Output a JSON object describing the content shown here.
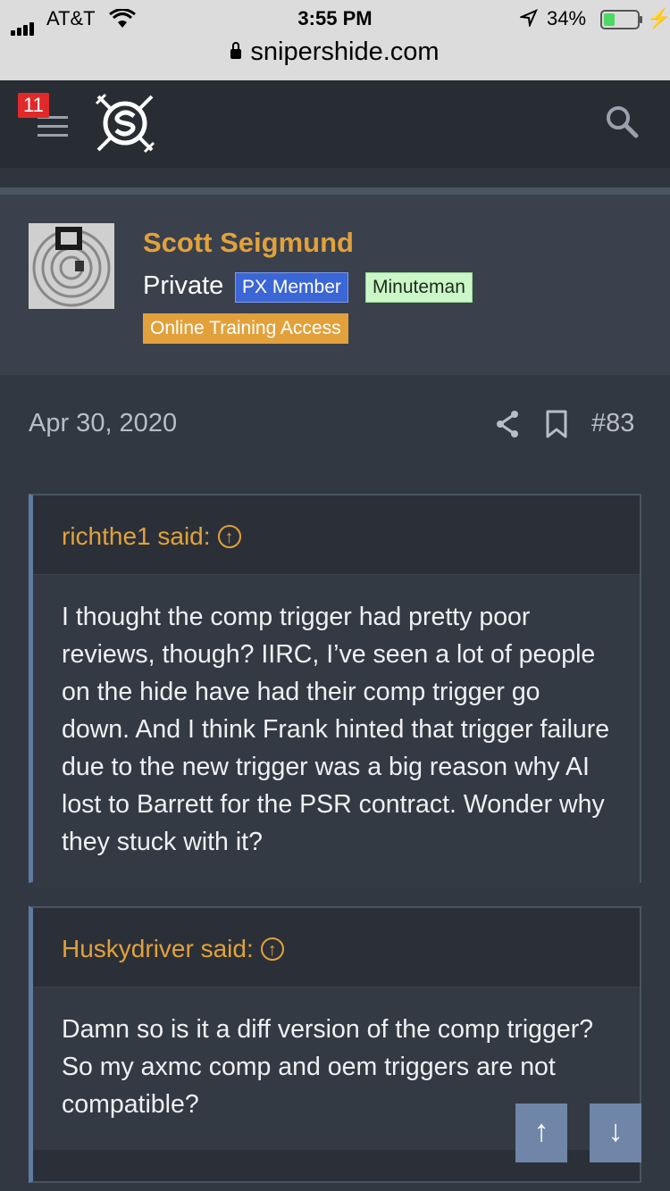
{
  "status_bar": {
    "carrier": "AT&T",
    "time": "3:55 PM",
    "battery_percent": "34%",
    "battery_level": 0.34,
    "url": "snipershide.com"
  },
  "nav": {
    "notification_count": "11",
    "icons": [
      "menu-icon",
      "site-logo",
      "search-icon"
    ]
  },
  "author": {
    "name": "Scott Seigmund",
    "rank": "Private",
    "banners": [
      "PX Member",
      "Minuteman",
      "Online Training Access"
    ]
  },
  "post": {
    "date": "Apr 30, 2020",
    "number": "#83",
    "icons": [
      "share-icon",
      "bookmark-icon"
    ]
  },
  "quotes": [
    {
      "author": "richthe1 said:",
      "arrow": "↑",
      "text": "I thought the comp trigger had pretty poor reviews, though? IIRC, I’ve seen a lot of people on the hide have had their comp trigger go down. And I think Frank hinted that trigger failure due to the new trigger was a big reason why AI lost to Barrett for the PSR contract. Wonder why they stuck with it?"
    },
    {
      "author": "Huskydriver said:",
      "arrow": "↑",
      "lines": [
        "Damn so is it a diff version of the comp trigger?",
        "So my axmc comp and oem triggers are not compatible?"
      ]
    }
  ],
  "scroll": {
    "up": "↑",
    "down": "↓"
  },
  "colors": {
    "accent": "#e2a13b",
    "background": "#323841",
    "header": "#282d34",
    "quote_border": "#5f7aa3"
  }
}
